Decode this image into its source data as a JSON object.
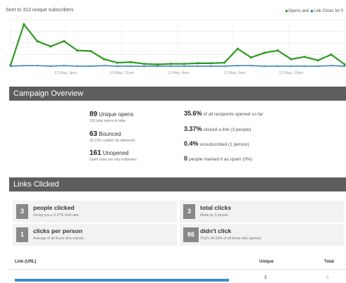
{
  "header": {
    "caption": "Sent to 313 unique subscribers",
    "legend": [
      {
        "label": "Opens and",
        "color": "#2e9a1e"
      },
      {
        "label": "Link Clicks for fi",
        "color": "#2c7ac0"
      }
    ]
  },
  "chart_data": {
    "type": "line",
    "categories": [
      "",
      "",
      "",
      "",
      "",
      "",
      "",
      "",
      "",
      "",
      "",
      "",
      "",
      "",
      "",
      "",
      "",
      "",
      "",
      "",
      "",
      "",
      "",
      "",
      ""
    ],
    "tick_labels": [
      "12 May, 3pm",
      "13 May, 12am",
      "13 May, 4am",
      "12 May, 9am",
      "13 May, 12pm"
    ],
    "series": [
      {
        "color": "#2e9a1e",
        "values": [
          2,
          72,
          43,
          34,
          43,
          27,
          26,
          12,
          6,
          7,
          4,
          3,
          4,
          4,
          5,
          5,
          6,
          30,
          15,
          23,
          27,
          12,
          16,
          10,
          20,
          3
        ]
      },
      {
        "color": "#2c7ac0",
        "values": [
          0,
          1,
          1,
          0,
          1,
          0,
          0,
          1,
          0,
          0,
          0,
          0,
          0,
          0,
          0,
          0,
          0,
          1,
          1,
          0,
          0,
          0,
          0,
          0,
          1,
          0
        ]
      }
    ],
    "ylim": [
      0,
      80
    ],
    "grid": true
  },
  "overview": {
    "title": "Campaign Overview",
    "left": [
      {
        "number": "89",
        "label": "Unique opens",
        "sub": "153 total opens to date"
      },
      {
        "number": "63",
        "label": "Bounced",
        "sub": "20.13% couldn't be delivered"
      },
      {
        "number": "161",
        "label": "Unopened",
        "sub": "Open rates are only estimates"
      }
    ],
    "right": [
      {
        "number": "35.6%",
        "label": "of all recipients opened so far"
      },
      {
        "number": "3.37%",
        "label": "clicked a link (3 people)"
      },
      {
        "number": "0.4%",
        "label": "unsubscribed (1 person)"
      },
      {
        "number": "0",
        "label": "people marked it as spam (0%)"
      }
    ]
  },
  "links": {
    "title": "Links Clicked",
    "cards": [
      {
        "number": "3",
        "title": "people clicked",
        "desc": "Giving you a 3.37% click rate."
      },
      {
        "number": "3",
        "title": "total clicks",
        "desc": "Made by 3 people"
      },
      {
        "number": "1",
        "title": "clicks per person",
        "desc": "Average of all those who clicked."
      },
      {
        "number": "86",
        "title": "didn't click",
        "desc": "That's 96.63% of all those who opened."
      }
    ],
    "table": {
      "headers": [
        "Link (URL)",
        "Unique",
        "Total"
      ],
      "rows": [
        {
          "unique": "3",
          "total": "3",
          "share": 1.0
        }
      ]
    }
  }
}
